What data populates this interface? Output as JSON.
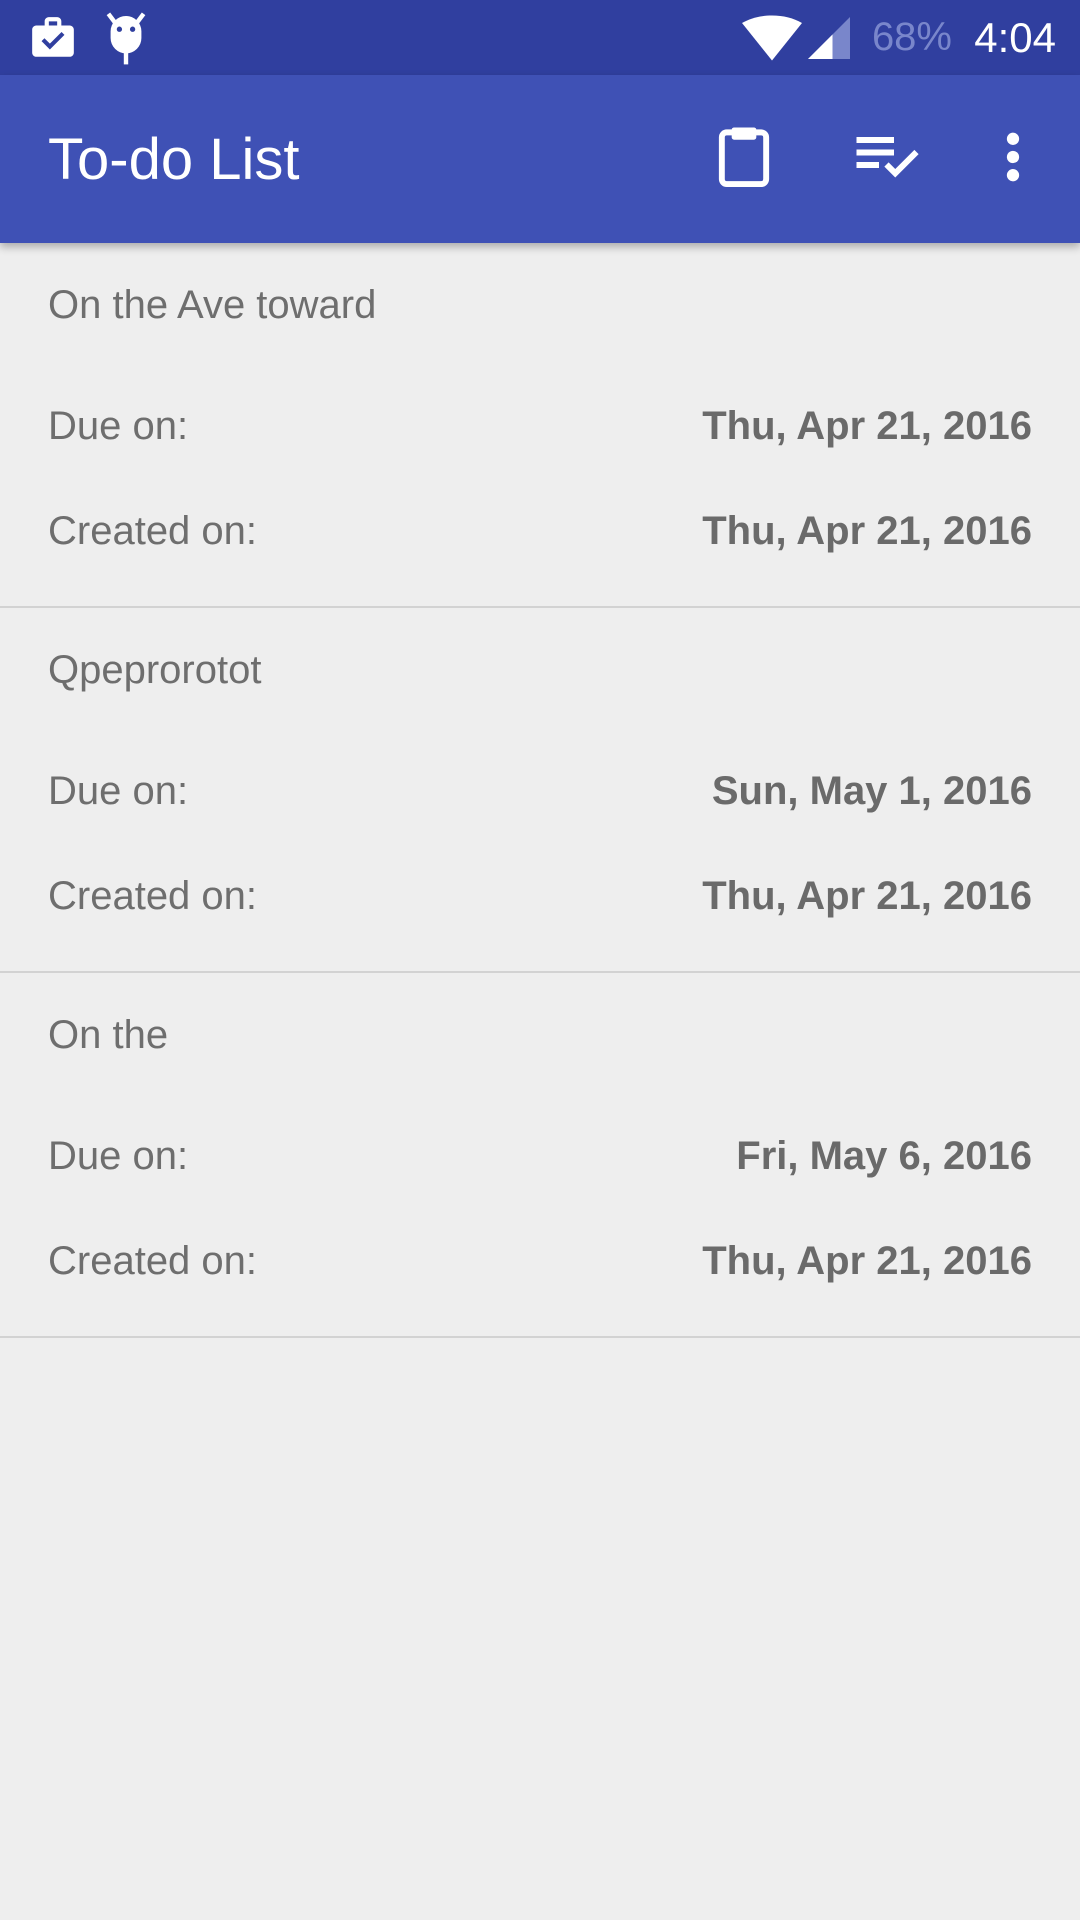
{
  "status_bar": {
    "battery": "68%",
    "time": "4:04",
    "icons": [
      "task-check-icon",
      "android-debug-icon",
      "wifi-icon",
      "cell-signal-icon"
    ]
  },
  "app_bar": {
    "title": "To-do List",
    "actions": [
      "clipboard-icon",
      "sort-checklist-icon",
      "overflow-menu-icon"
    ]
  },
  "colors": {
    "status_bar": "#303f9f",
    "app_bar": "#3f51b5",
    "background": "#eeeeee",
    "text": "#6e6e6e"
  },
  "todos": [
    {
      "title": "On the Ave toward",
      "due_label": "Due on:",
      "due": "Thu, Apr 21, 2016",
      "created_label": "Created on:",
      "created": "Thu, Apr 21, 2016"
    },
    {
      "title": "Qpeprorotot",
      "due_label": "Due on:",
      "due": "Sun, May 1, 2016",
      "created_label": "Created on:",
      "created": "Thu, Apr 21, 2016"
    },
    {
      "title": "On the",
      "due_label": "Due on:",
      "due": "Fri, May 6, 2016",
      "created_label": "Created on:",
      "created": "Thu, Apr 21, 2016"
    }
  ]
}
